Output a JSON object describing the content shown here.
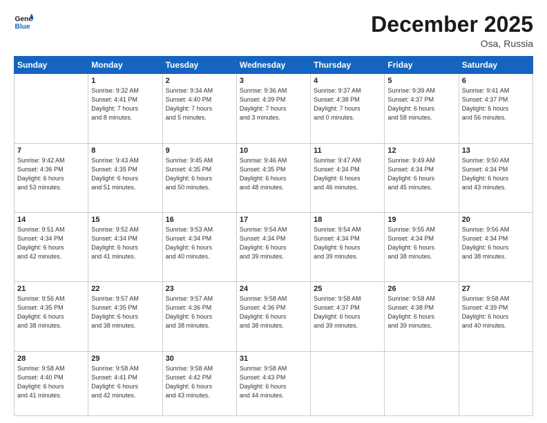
{
  "header": {
    "logo_line1": "General",
    "logo_line2": "Blue",
    "month": "December 2025",
    "location": "Osa, Russia"
  },
  "weekdays": [
    "Sunday",
    "Monday",
    "Tuesday",
    "Wednesday",
    "Thursday",
    "Friday",
    "Saturday"
  ],
  "weeks": [
    [
      {
        "day": "",
        "content": ""
      },
      {
        "day": "1",
        "content": "Sunrise: 9:32 AM\nSunset: 4:41 PM\nDaylight: 7 hours\nand 8 minutes."
      },
      {
        "day": "2",
        "content": "Sunrise: 9:34 AM\nSunset: 4:40 PM\nDaylight: 7 hours\nand 5 minutes."
      },
      {
        "day": "3",
        "content": "Sunrise: 9:36 AM\nSunset: 4:39 PM\nDaylight: 7 hours\nand 3 minutes."
      },
      {
        "day": "4",
        "content": "Sunrise: 9:37 AM\nSunset: 4:38 PM\nDaylight: 7 hours\nand 0 minutes."
      },
      {
        "day": "5",
        "content": "Sunrise: 9:39 AM\nSunset: 4:37 PM\nDaylight: 6 hours\nand 58 minutes."
      },
      {
        "day": "6",
        "content": "Sunrise: 9:41 AM\nSunset: 4:37 PM\nDaylight: 6 hours\nand 56 minutes."
      }
    ],
    [
      {
        "day": "7",
        "content": "Sunrise: 9:42 AM\nSunset: 4:36 PM\nDaylight: 6 hours\nand 53 minutes."
      },
      {
        "day": "8",
        "content": "Sunrise: 9:43 AM\nSunset: 4:35 PM\nDaylight: 6 hours\nand 51 minutes."
      },
      {
        "day": "9",
        "content": "Sunrise: 9:45 AM\nSunset: 4:35 PM\nDaylight: 6 hours\nand 50 minutes."
      },
      {
        "day": "10",
        "content": "Sunrise: 9:46 AM\nSunset: 4:35 PM\nDaylight: 6 hours\nand 48 minutes."
      },
      {
        "day": "11",
        "content": "Sunrise: 9:47 AM\nSunset: 4:34 PM\nDaylight: 6 hours\nand 46 minutes."
      },
      {
        "day": "12",
        "content": "Sunrise: 9:49 AM\nSunset: 4:34 PM\nDaylight: 6 hours\nand 45 minutes."
      },
      {
        "day": "13",
        "content": "Sunrise: 9:50 AM\nSunset: 4:34 PM\nDaylight: 6 hours\nand 43 minutes."
      }
    ],
    [
      {
        "day": "14",
        "content": "Sunrise: 9:51 AM\nSunset: 4:34 PM\nDaylight: 6 hours\nand 42 minutes."
      },
      {
        "day": "15",
        "content": "Sunrise: 9:52 AM\nSunset: 4:34 PM\nDaylight: 6 hours\nand 41 minutes."
      },
      {
        "day": "16",
        "content": "Sunrise: 9:53 AM\nSunset: 4:34 PM\nDaylight: 6 hours\nand 40 minutes."
      },
      {
        "day": "17",
        "content": "Sunrise: 9:54 AM\nSunset: 4:34 PM\nDaylight: 6 hours\nand 39 minutes."
      },
      {
        "day": "18",
        "content": "Sunrise: 9:54 AM\nSunset: 4:34 PM\nDaylight: 6 hours\nand 39 minutes."
      },
      {
        "day": "19",
        "content": "Sunrise: 9:55 AM\nSunset: 4:34 PM\nDaylight: 6 hours\nand 38 minutes."
      },
      {
        "day": "20",
        "content": "Sunrise: 9:56 AM\nSunset: 4:34 PM\nDaylight: 6 hours\nand 38 minutes."
      }
    ],
    [
      {
        "day": "21",
        "content": "Sunrise: 9:56 AM\nSunset: 4:35 PM\nDaylight: 6 hours\nand 38 minutes."
      },
      {
        "day": "22",
        "content": "Sunrise: 9:57 AM\nSunset: 4:35 PM\nDaylight: 6 hours\nand 38 minutes."
      },
      {
        "day": "23",
        "content": "Sunrise: 9:57 AM\nSunset: 4:36 PM\nDaylight: 6 hours\nand 38 minutes."
      },
      {
        "day": "24",
        "content": "Sunrise: 9:58 AM\nSunset: 4:36 PM\nDaylight: 6 hours\nand 38 minutes."
      },
      {
        "day": "25",
        "content": "Sunrise: 9:58 AM\nSunset: 4:37 PM\nDaylight: 6 hours\nand 39 minutes."
      },
      {
        "day": "26",
        "content": "Sunrise: 9:58 AM\nSunset: 4:38 PM\nDaylight: 6 hours\nand 39 minutes."
      },
      {
        "day": "27",
        "content": "Sunrise: 9:58 AM\nSunset: 4:39 PM\nDaylight: 6 hours\nand 40 minutes."
      }
    ],
    [
      {
        "day": "28",
        "content": "Sunrise: 9:58 AM\nSunset: 4:40 PM\nDaylight: 6 hours\nand 41 minutes."
      },
      {
        "day": "29",
        "content": "Sunrise: 9:58 AM\nSunset: 4:41 PM\nDaylight: 6 hours\nand 42 minutes."
      },
      {
        "day": "30",
        "content": "Sunrise: 9:58 AM\nSunset: 4:42 PM\nDaylight: 6 hours\nand 43 minutes."
      },
      {
        "day": "31",
        "content": "Sunrise: 9:58 AM\nSunset: 4:43 PM\nDaylight: 6 hours\nand 44 minutes."
      },
      {
        "day": "",
        "content": ""
      },
      {
        "day": "",
        "content": ""
      },
      {
        "day": "",
        "content": ""
      }
    ]
  ]
}
